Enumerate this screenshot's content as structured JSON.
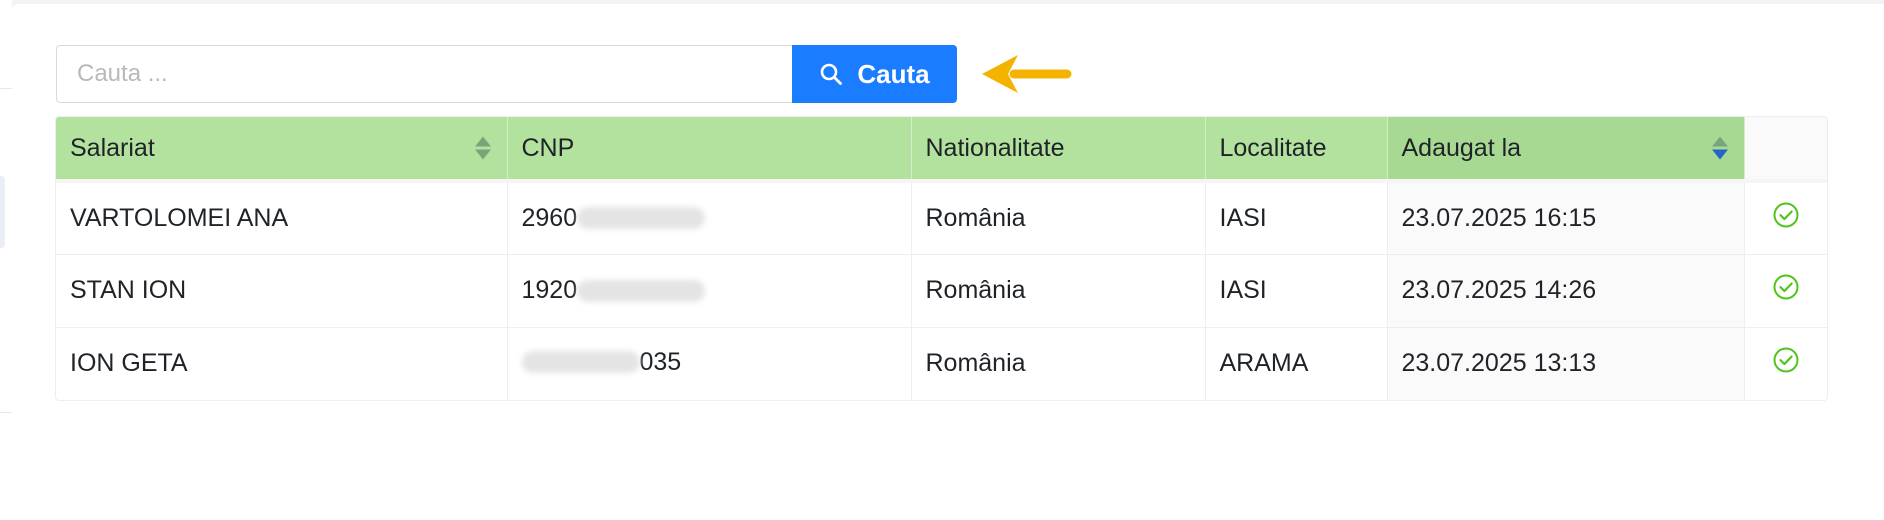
{
  "search": {
    "placeholder": "Cauta ...",
    "button_label": "Cauta",
    "button_icon": "search-icon"
  },
  "annotation": {
    "icon": "arrow-left-icon",
    "color": "#f5b301"
  },
  "table": {
    "columns": [
      {
        "label": "Salariat",
        "sortable": true,
        "sort": "none"
      },
      {
        "label": "CNP"
      },
      {
        "label": "Nationalitate"
      },
      {
        "label": "Localitate"
      },
      {
        "label": "Adaugat la",
        "sortable": true,
        "sort": "descending"
      },
      {
        "label": ""
      }
    ],
    "rows": [
      {
        "salariat": "VARTOLOMEI ANA",
        "cnp_prefix": "2960",
        "cnp_suffix": "",
        "nationalitate": "România",
        "localitate": "IASI",
        "adaugat_la": "23.07.2025 16:15",
        "status_icon": "check-circle-icon"
      },
      {
        "salariat": "STAN ION",
        "cnp_prefix": "1920",
        "cnp_suffix": "",
        "nationalitate": "România",
        "localitate": "IASI",
        "adaugat_la": "23.07.2025 14:26",
        "status_icon": "check-circle-icon"
      },
      {
        "salariat": "ION GETA",
        "cnp_prefix": "",
        "cnp_suffix": "035",
        "nationalitate": "România",
        "localitate": "ARAMA",
        "adaugat_la": "23.07.2025 13:13",
        "status_icon": "check-circle-icon"
      }
    ]
  },
  "colors": {
    "header_bg": "#b3e29f",
    "button_bg": "#1a7cff",
    "check_color": "#52c41a",
    "sort_active": "#2165c9"
  }
}
